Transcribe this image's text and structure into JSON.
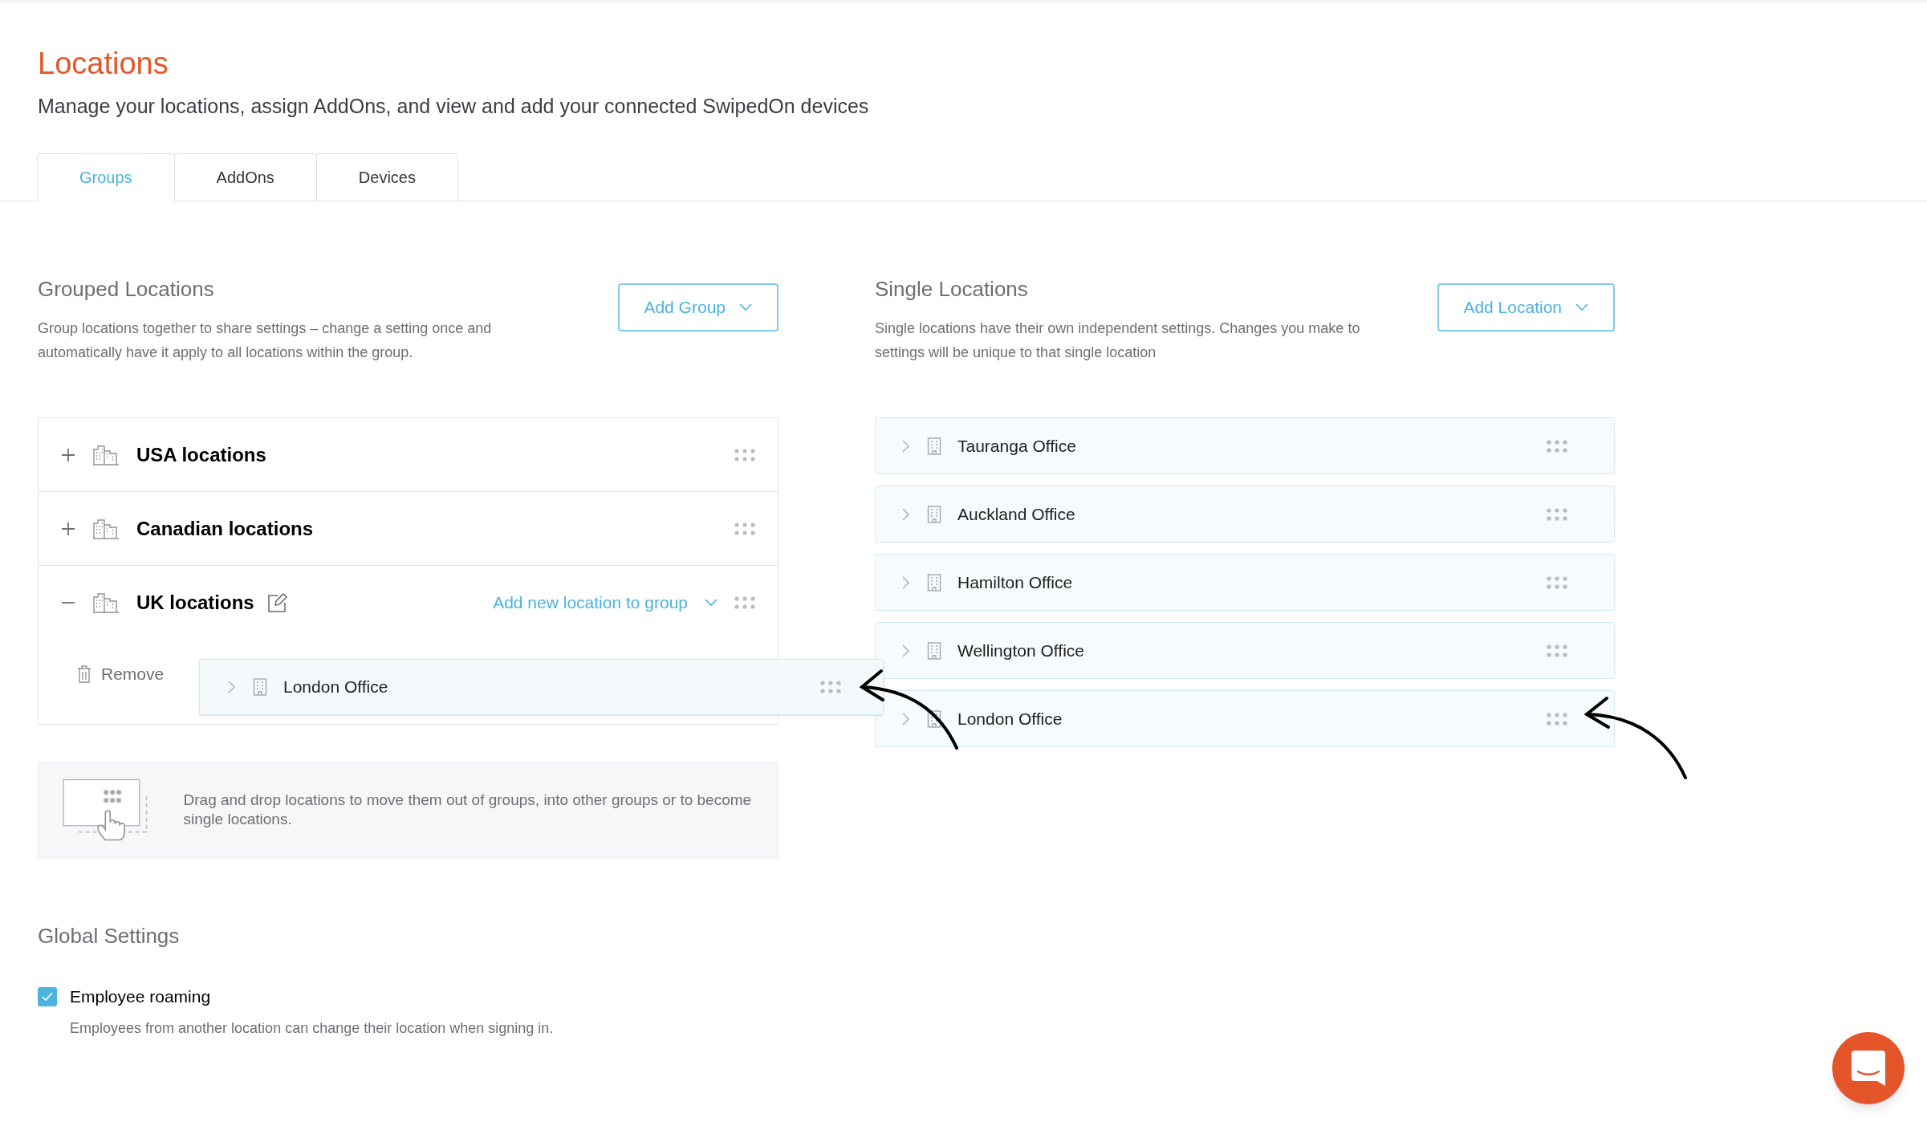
{
  "page": {
    "title": "Locations",
    "subtitle": "Manage your locations, assign AddOns, and view and add your connected SwipedOn devices"
  },
  "tabs": [
    {
      "label": "Groups",
      "selected": true
    },
    {
      "label": "AddOns",
      "selected": false
    },
    {
      "label": "Devices",
      "selected": false
    }
  ],
  "grouped": {
    "heading": "Grouped Locations",
    "description": "Group locations together to share settings – change a setting once and automatically have it apply to all locations within the group.",
    "add_button": "Add Group",
    "groups": [
      {
        "name": "USA locations",
        "expanded": false
      },
      {
        "name": "Canadian locations",
        "expanded": false
      },
      {
        "name": "UK locations",
        "expanded": true,
        "add_link": "Add new location to group",
        "remove_label": "Remove",
        "dragged_location": "London Office"
      }
    ],
    "hint": "Drag and drop locations to move them out of groups, into other groups or to become single locations."
  },
  "single": {
    "heading": "Single Locations",
    "description": "Single locations have their own independent settings. Changes you make to settings will be unique to that single location",
    "add_button": "Add Location",
    "locations": [
      {
        "name": "Tauranga Office"
      },
      {
        "name": "Auckland Office"
      },
      {
        "name": "Hamilton Office"
      },
      {
        "name": "Wellington Office"
      },
      {
        "name": "London Office"
      }
    ]
  },
  "global": {
    "heading": "Global Settings",
    "settings": [
      {
        "label": "Employee roaming",
        "description": "Employees from another location can change their location when signing in.",
        "checked": true
      }
    ]
  }
}
